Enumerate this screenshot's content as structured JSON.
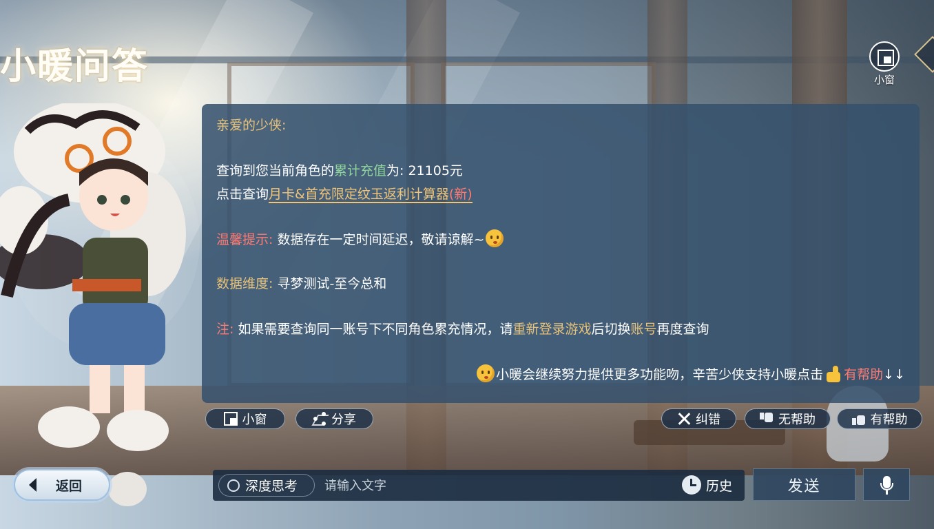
{
  "header": {
    "title": "小暖问答",
    "mini_window_label": "小窗"
  },
  "answer": {
    "greeting": "亲爱的少侠:",
    "query_prefix": "查询到您当前角色的",
    "query_highlight": "累计充值",
    "query_suffix": "为: 21105元",
    "click_prefix": "点击查询",
    "calculator_link": "月卡&首充限定纹玉返利计算器",
    "calculator_new": "(新)",
    "tip_label": "温馨提示:",
    "tip_text": " 数据存在一定时间延迟，敬请谅解~",
    "dimension_label": "数据维度:",
    "dimension_value": " 寻梦测试-至今总和",
    "note_label": "注:",
    "note_text_1": " 如果需要查询同一账号下不同角色累充情况，请",
    "note_highlight_1": "重新登录游戏",
    "note_text_2": "后切换",
    "note_highlight_2": "账号",
    "note_text_3": "再度查询",
    "closing_text": "小暖会继续努力提供更多功能吻，辛苦少侠支持小暖点击",
    "closing_helpful": "有帮助",
    "closing_arrows": "↓↓"
  },
  "actions": {
    "mini_window": "小窗",
    "share": "分享",
    "correct": "纠错",
    "not_helpful": "无帮助",
    "helpful": "有帮助"
  },
  "bottom": {
    "back": "返回",
    "deep_think": "深度思考",
    "input_placeholder": "请输入文字",
    "history": "历史",
    "send": "发送"
  },
  "colors": {
    "panel_bg": "#34506c",
    "gold": "#e7c27a",
    "green": "#8fd59a",
    "red": "#ff7a72"
  }
}
